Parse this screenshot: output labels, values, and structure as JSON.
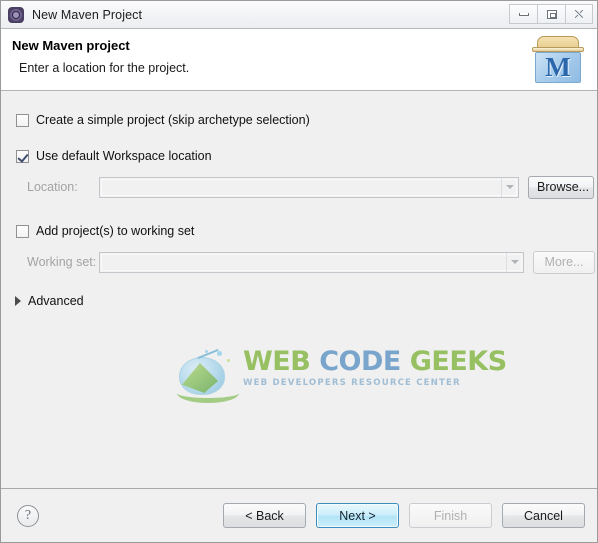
{
  "window": {
    "title": "New Maven Project",
    "icon": "maven-gear-icon",
    "controls": {
      "minimize": "minimize-icon",
      "maximize": "restore-icon",
      "close": "close-icon"
    }
  },
  "header": {
    "title": "New Maven project",
    "subtitle": "Enter a location for the project.",
    "logo_letter": "M",
    "logo_name": "maven-box-logo"
  },
  "form": {
    "simple_project": {
      "label": "Create a simple project (skip archetype selection)",
      "checked": false
    },
    "default_workspace": {
      "label": "Use default Workspace location",
      "checked": true
    },
    "location": {
      "label": "Location:",
      "value": "",
      "placeholder": "",
      "disabled": true,
      "browse_button": "Browse..."
    },
    "working_set_checkbox": {
      "label": "Add project(s) to working set",
      "checked": false
    },
    "working_set": {
      "label": "Working set:",
      "value": "",
      "placeholder": "",
      "disabled": true,
      "more_button": "More..."
    },
    "advanced": {
      "label": "Advanced",
      "expanded": false
    }
  },
  "watermark": {
    "word1": "WEB",
    "word2": "CODE",
    "word3": "GEEKS",
    "tagline": "WEB DEVELOPERS RESOURCE CENTER",
    "color_green": "#8fbc57",
    "color_blue": "#6f9fc9",
    "tagline_color": "#9bbad3"
  },
  "footer": {
    "help": "?",
    "back_button": "< Back",
    "next_button": "Next >",
    "finish_button": "Finish",
    "cancel_button": "Cancel",
    "next_accent": "#3c8dbc"
  }
}
